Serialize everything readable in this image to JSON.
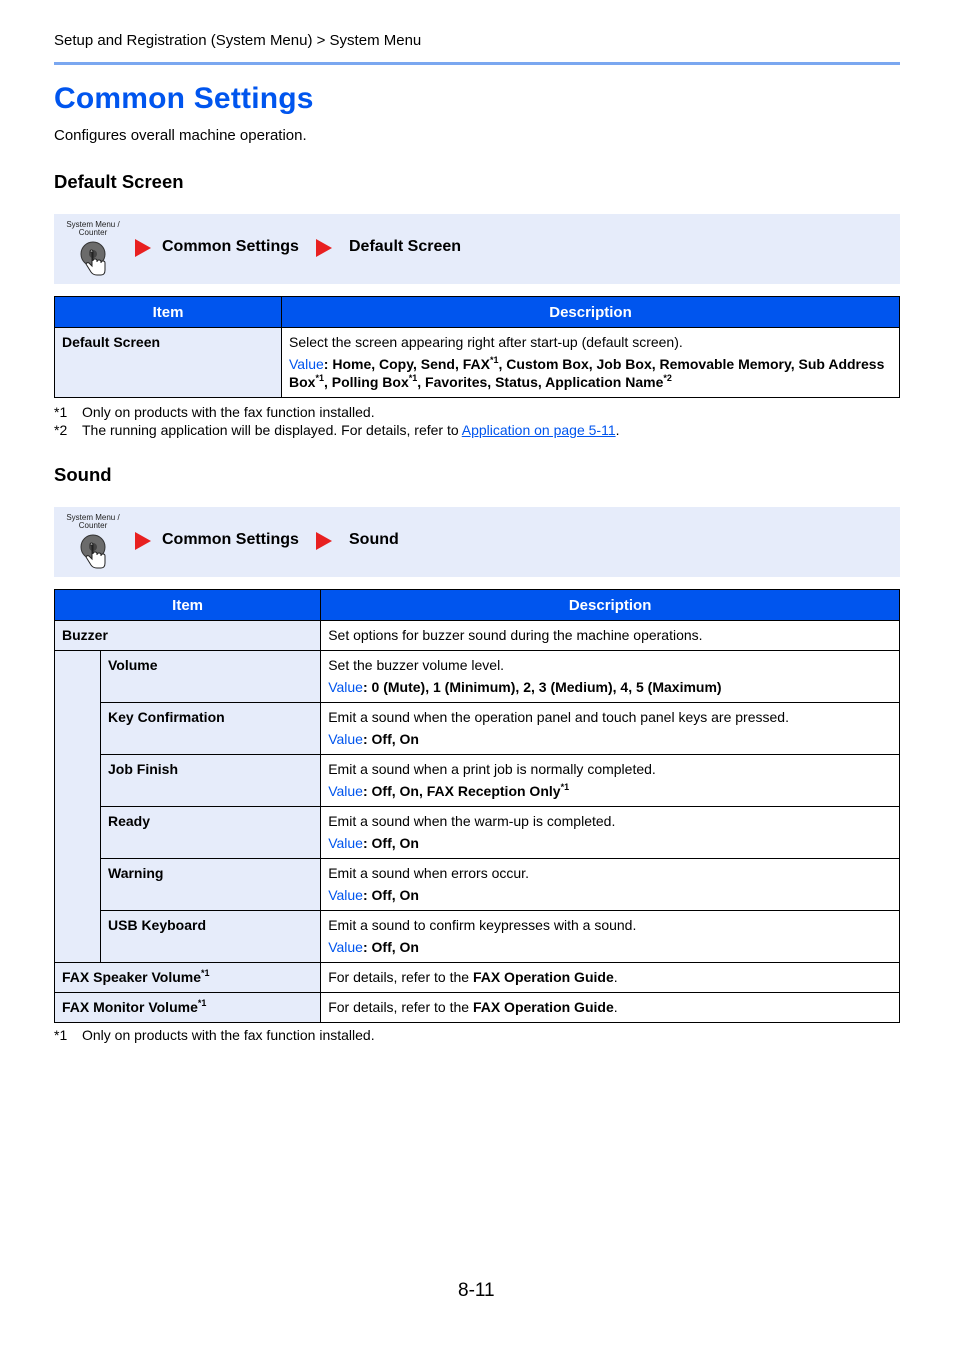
{
  "header": {
    "breadcrumb": "Setup and Registration (System Menu) > System Menu"
  },
  "page": {
    "title": "Common Settings",
    "intro": "Configures overall machine operation.",
    "page_number": "8-11",
    "accent_color": "#0055ee"
  },
  "sections": [
    {
      "heading": "Default Screen",
      "nav_path": {
        "button_label_line1": "System Menu /",
        "button_label_line2": "Counter",
        "icon": "system-menu-counter-button-icon",
        "steps": [
          "Common Settings",
          "Default Screen"
        ]
      },
      "table": {
        "headers": [
          "Item",
          "Description"
        ],
        "rows": [
          {
            "item": "Default Screen",
            "description": "Select the screen appearing right after start-up (default screen).",
            "value_label": "Value",
            "value_parts": [
              {
                "text": ": Home, Copy, Send, FAX",
                "sup": "*1"
              },
              {
                "text": ", Custom Box, Job Box, Removable Memory, Sub Address Box",
                "sup": "*1"
              },
              {
                "text": ", Polling Box",
                "sup": "*1"
              },
              {
                "text": ", Favorites, Status, Application Name",
                "sup": "*2"
              }
            ]
          }
        ]
      },
      "footnotes": [
        {
          "mark": "*1",
          "text": "Only on products with the fax function installed."
        },
        {
          "mark": "*2",
          "text": "The running application will be displayed. For details, refer to ",
          "link": "Application on page 5-11",
          "after": "."
        }
      ]
    },
    {
      "heading": "Sound",
      "nav_path": {
        "button_label_line1": "System Menu /",
        "button_label_line2": "Counter",
        "icon": "system-menu-counter-button-icon",
        "steps": [
          "Common Settings",
          "Sound"
        ]
      },
      "table": {
        "headers": [
          "Item",
          "Description"
        ],
        "buzzer": {
          "item": "Buzzer",
          "description": "Set options for buzzer sound during the machine operations."
        },
        "sub_rows": [
          {
            "item": "Volume",
            "description": "Set the buzzer volume level.",
            "value_label": "Value",
            "value": ": 0 (Mute), 1 (Minimum), 2, 3 (Medium), 4, 5 (Maximum)",
            "sup": ""
          },
          {
            "item": "Key Confirmation",
            "description": "Emit a sound when the operation panel and touch panel keys are pressed.",
            "value_label": "Value",
            "value": ": Off, On",
            "sup": ""
          },
          {
            "item": "Job Finish",
            "description": "Emit a sound when a print job is normally completed.",
            "value_label": "Value",
            "value": ": Off, On, FAX Reception Only",
            "sup": "*1"
          },
          {
            "item": "Ready",
            "description": "Emit a sound when the warm-up is completed.",
            "value_label": "Value",
            "value": ": Off, On",
            "sup": ""
          },
          {
            "item": "Warning",
            "description": "Emit a sound when errors occur.",
            "value_label": "Value",
            "value": ": Off, On",
            "sup": ""
          },
          {
            "item": "USB Keyboard",
            "description": "Emit a sound to confirm keypresses with a sound.",
            "value_label": "Value",
            "value": ": Off, On",
            "sup": ""
          }
        ],
        "fax_rows": [
          {
            "item": "FAX Speaker Volume",
            "sup": "*1",
            "description_prefix": "For details, refer to the ",
            "description_bold": "FAX Operation Guide",
            "description_suffix": "."
          },
          {
            "item": "FAX Monitor Volume",
            "sup": "*1",
            "description_prefix": "For details, refer to the ",
            "description_bold": "FAX Operation Guide",
            "description_suffix": "."
          }
        ]
      },
      "footnotes": [
        {
          "mark": "*1",
          "text": "Only on products with the fax function installed."
        }
      ]
    }
  ]
}
